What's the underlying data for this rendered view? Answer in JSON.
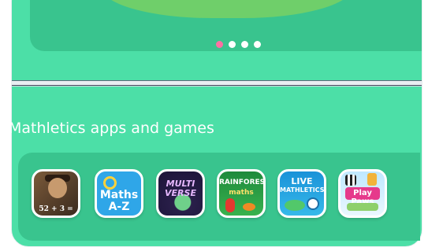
{
  "carousel": {
    "slide_count": 4,
    "active_index": 0,
    "colors": {
      "active": "#ff6fa3",
      "inactive": "#ffffff"
    }
  },
  "section": {
    "title": "Mathletics apps and games"
  },
  "apps": [
    {
      "name": "maths-history-app",
      "icon_text": "52 + 3 = "
    },
    {
      "name": "maths-a-z-app",
      "icon_text_1": "Maths",
      "icon_text_2": "A-Z"
    },
    {
      "name": "multiverse-app",
      "icon_text": "MULTI VERSE"
    },
    {
      "name": "rainforest-maths-app",
      "icon_text_1": "RAINFOREST",
      "icon_text_2": "maths"
    },
    {
      "name": "live-mathletics-app",
      "icon_text_1": "LIVE",
      "icon_text_2": "MATHLETICS"
    },
    {
      "name": "play-paws-app",
      "icon_text": "Play Paws"
    }
  ],
  "colors": {
    "background": "#4cdfa7",
    "panel": "#39c48e",
    "text": "#ffffff"
  }
}
